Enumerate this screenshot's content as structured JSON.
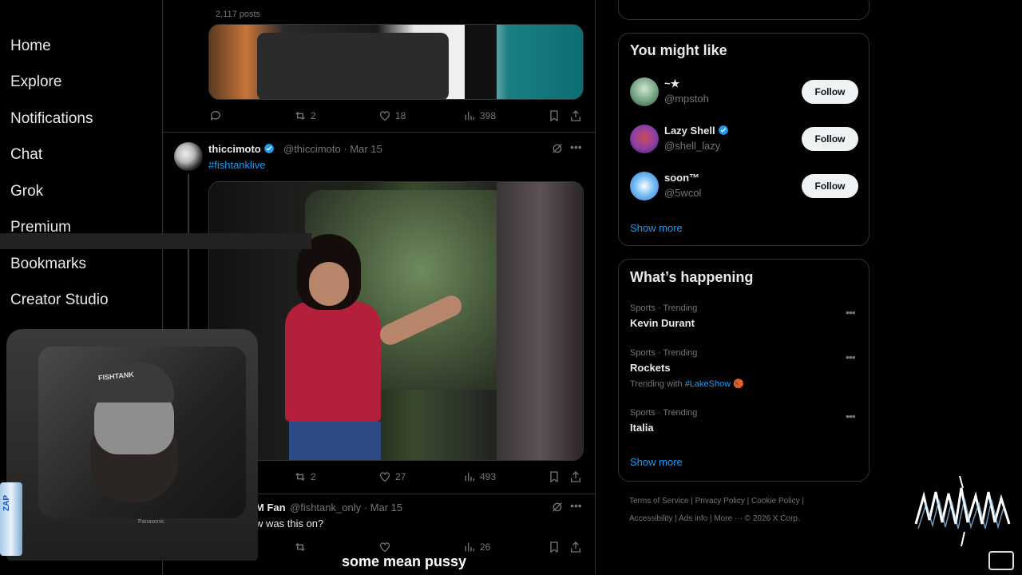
{
  "nav": {
    "items": [
      "Home",
      "Explore",
      "Notifications",
      "Chat",
      "Grok",
      "Premium",
      "Bookmarks",
      "Creator Studio"
    ]
  },
  "feed": {
    "post_count": "2,117 posts",
    "tweet1": {
      "replies": "",
      "reposts": "2",
      "likes": "18",
      "views": "398"
    },
    "tweet2": {
      "name": "thiccimoto",
      "handle": "@thiccimoto",
      "date": "· Mar 15",
      "hashtag": "#fishtanklive",
      "reposts": "2",
      "likes": "27",
      "views": "493"
    },
    "tweet3": {
      "name": "M Fan",
      "handle": "@fishtank_only",
      "date": "· Mar 15",
      "text": "w was this on?",
      "likes": "",
      "views": "26"
    }
  },
  "might_like": {
    "title": "You might like",
    "users": [
      {
        "name": "~★",
        "handle": "@mpstoh",
        "verified": false,
        "follow": "Follow",
        "avatar_color": "#6a9a7a"
      },
      {
        "name": "Lazy Shell",
        "handle": "@shell_lazy",
        "verified": true,
        "follow": "Follow",
        "avatar_color": "#8a3fa8"
      },
      {
        "name": "soon™",
        "handle": "@5wcol",
        "verified": false,
        "follow": "Follow",
        "avatar_color": "#3a8ad8"
      }
    ],
    "show_more": "Show more"
  },
  "happening": {
    "title": "What’s happening",
    "trends": [
      {
        "meta": "Sports · Trending",
        "name": "Kevin Durant",
        "sub": ""
      },
      {
        "meta": "Sports · Trending",
        "name": "Rockets",
        "sub_prefix": "Trending with",
        "sub_tag": "#LakeShow",
        "sub_emoji": "🏀"
      },
      {
        "meta": "Sports · Trending",
        "name": "Italia",
        "sub": ""
      }
    ],
    "show_more": "Show more"
  },
  "footer": {
    "line1": "Terms of Service  |  Privacy Policy  |  Cookie Policy  |",
    "line2": "Accessibility  |  Ads info  |  More ···  © 2026 X Corp."
  },
  "overlay": {
    "hat_text": "FISHTANK",
    "tv_brand": "Panasonic",
    "can_text": "ZAP",
    "caption": "some mean pussy"
  },
  "colors": {
    "accent": "#1d9bf0",
    "background": "#000000",
    "border": "#2f3336",
    "muted": "#71767b"
  }
}
